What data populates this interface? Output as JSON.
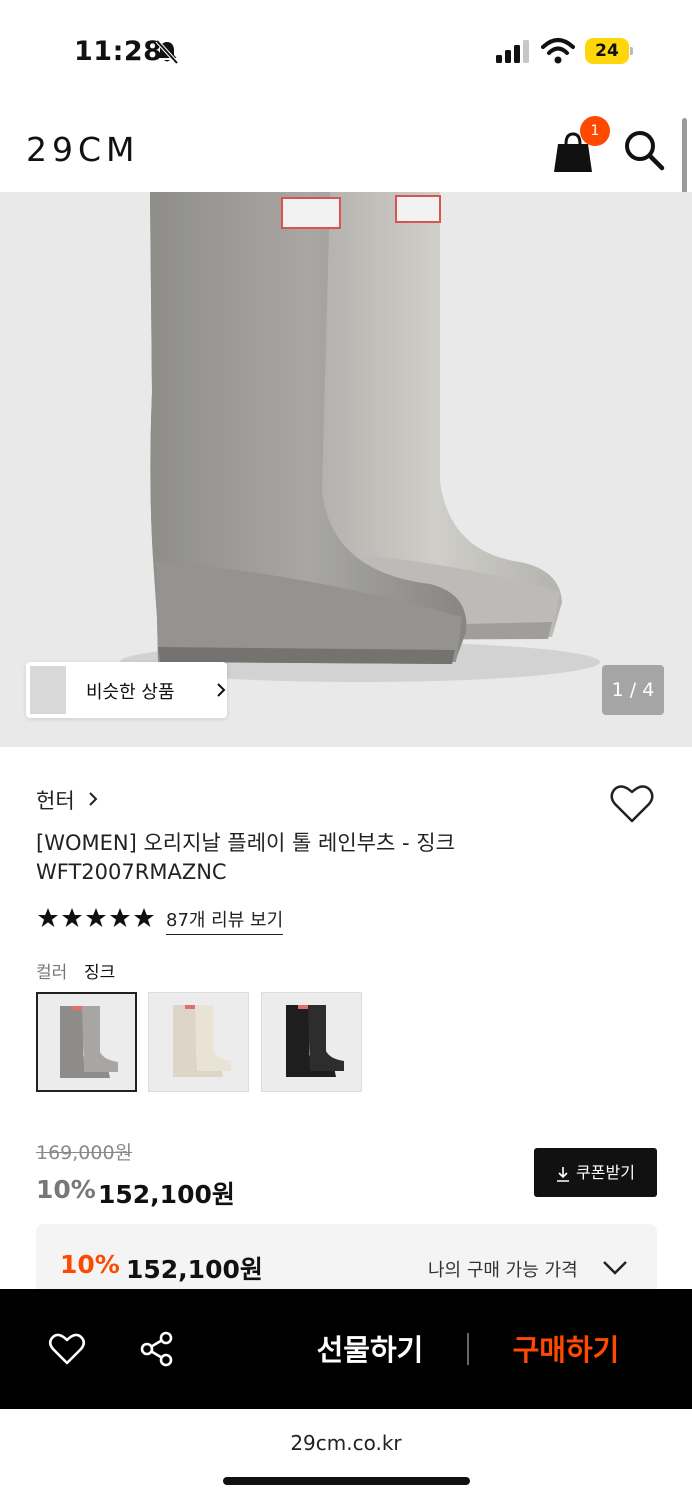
{
  "status_bar": {
    "time": "11:28",
    "battery": "24"
  },
  "header": {
    "logo": "29CM",
    "cart_count": "1"
  },
  "gallery": {
    "similar_label": "비슷한 상품",
    "page_counter": "1 / 4"
  },
  "product": {
    "brand": "헌터",
    "title": "[WOMEN] 오리지날 플레이 톨 레인부츠 - 징크",
    "code": "WFT2007RMAZNC",
    "review_link": "87개 리뷰 보기",
    "color_label": "컬러",
    "color_value": "징크",
    "colors": [
      "zinc-grey",
      "cream",
      "black"
    ]
  },
  "pricing": {
    "original": "169,000원",
    "discount_rate": "10%",
    "sale_price": "152,100원",
    "coupon_label": "쿠폰받기",
    "best_rate": "10%",
    "best_price": "152,100원",
    "best_label": "나의 구매 가능 가격"
  },
  "actions": {
    "gift": "선물하기",
    "buy": "구매하기"
  },
  "browser": {
    "url": "29cm.co.kr"
  },
  "colors": {
    "accent": "#ff4800",
    "bar": "#000000"
  }
}
